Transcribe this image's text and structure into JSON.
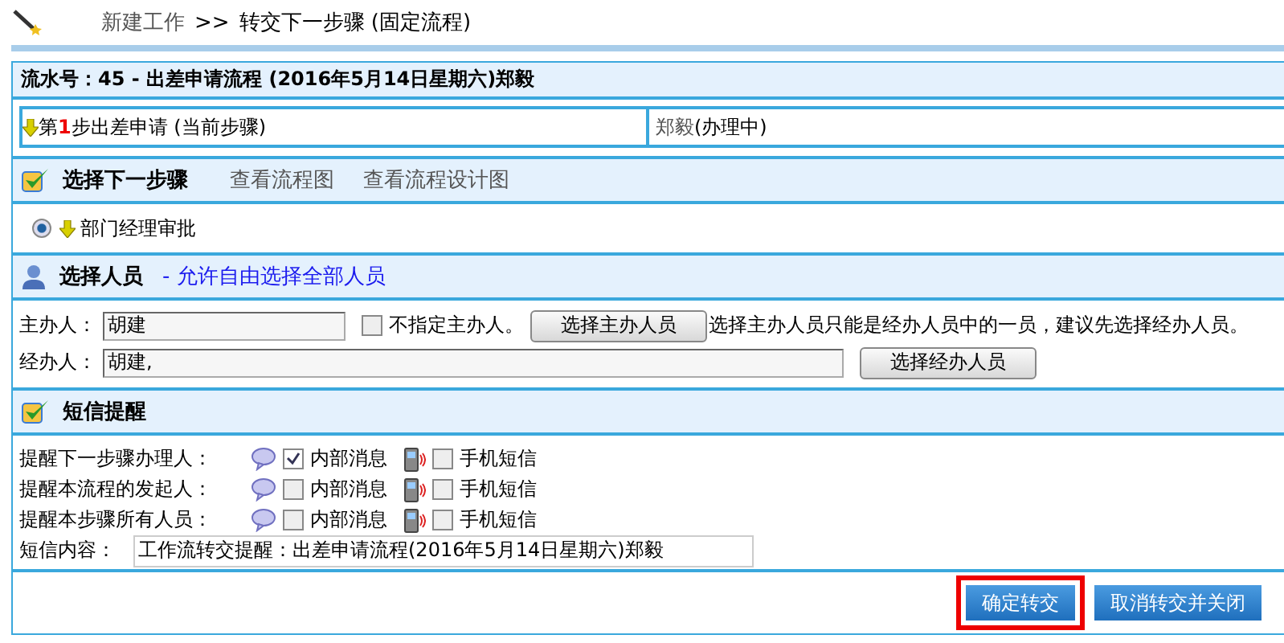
{
  "breadcrumb": {
    "items": [
      "新建工作",
      "转交下一步骤 (固定流程)"
    ],
    "separator": ">>"
  },
  "serial_title": "流水号：45 - 出差申请流程 (2016年5月14日星期六)郑毅",
  "current_step": {
    "prefix": "第",
    "number": "1",
    "suffix": "步出差申请 (当前步骤)",
    "handler": "郑毅",
    "handler_status": "(办理中)"
  },
  "next_step": {
    "title": "选择下一步骤",
    "links": [
      "查看流程图",
      "查看流程设计图"
    ],
    "options": [
      {
        "label": "部门经理审批",
        "selected": true
      }
    ]
  },
  "personnel": {
    "title": "选择人员",
    "note": "- 允许自由选择全部人员",
    "host_label": "主办人：",
    "host_value": "胡建",
    "no_host": {
      "label": "不指定主办人。",
      "checked": false
    },
    "host_button": "选择主办人员",
    "hint": "选择主办人员只能是经办人员中的一员，建议先选择经办人员。",
    "handlers_label": "经办人：",
    "handlers_value": "胡建,",
    "handlers_button": "选择经办人员"
  },
  "sms": {
    "title": "短信提醒",
    "rows": [
      {
        "label": "提醒下一步骤办理人：",
        "internal": {
          "label": "内部消息",
          "checked": true
        },
        "mobile": {
          "label": "手机短信",
          "checked": false
        }
      },
      {
        "label": "提醒本流程的发起人：",
        "internal": {
          "label": "内部消息",
          "checked": false
        },
        "mobile": {
          "label": "手机短信",
          "checked": false
        }
      },
      {
        "label": "提醒本步骤所有人员：",
        "internal": {
          "label": "内部消息",
          "checked": false
        },
        "mobile": {
          "label": "手机短信",
          "checked": false
        }
      }
    ],
    "content_label": "短信内容：",
    "content_value": "工作流转交提醒：出差申请流程(2016年5月14日星期六)郑毅"
  },
  "buttons": [
    {
      "label": "确定转交",
      "highlighted": true
    },
    {
      "label": "取消转交并关闭",
      "highlighted": false
    }
  ]
}
